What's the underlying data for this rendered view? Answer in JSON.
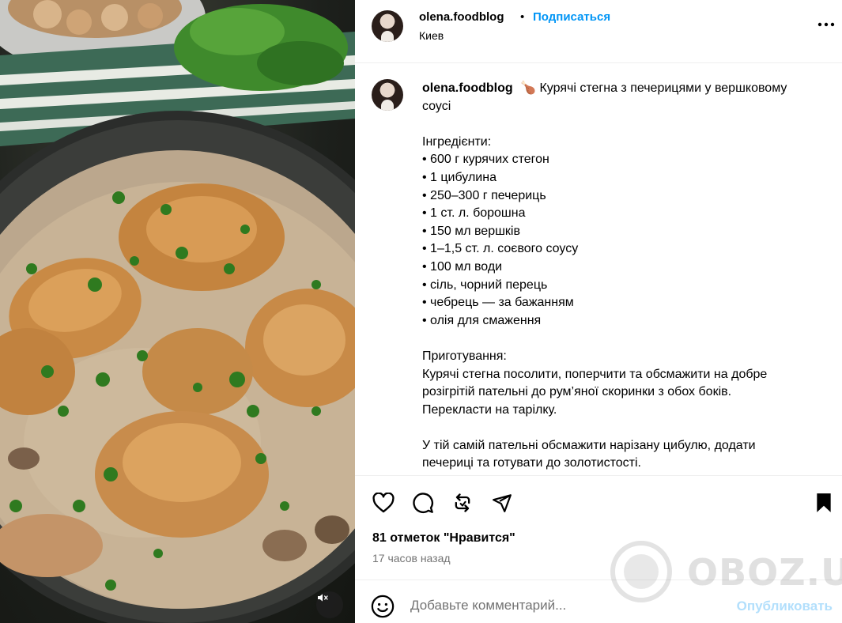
{
  "post": {
    "username": "olena.foodblog",
    "separator": "•",
    "follow_label": "Подписаться",
    "location": "Киев",
    "caption_emoji": "🍗",
    "caption_lines": [
      "Курячі стегна з печерицями у вершковому",
      "соусі",
      "",
      "Інгредієнти:",
      "• 600 г курячих стегон",
      "• 1 цибулина",
      "• 250–300 г печериць",
      "• 1 ст. л. борошна",
      "• 150 мл вершків",
      "• 1–1,5 ст. л. соєвого соусу",
      "• 100 мл води",
      "• сіль, чорний перець",
      "• чебрець — за бажанням",
      "• олія для смаження",
      "",
      "Приготування:",
      "Курячі стегна посолити, поперчити та обсмажити на добре",
      "розігрітій пательні до рум’яної скоринки з обох боків.",
      "Перекласти на тарілку.",
      "",
      "У тій самій пательні обсмажити нарізану цибулю, додати",
      "печериці та готувати до золотистості."
    ],
    "likes": "81 отметок \"Нравится\"",
    "time_ago": "17 часов назад"
  },
  "comment": {
    "placeholder": "Добавьте комментарий...",
    "publish_label": "Опубликовать"
  },
  "watermark": {
    "text": "OBOZ.UA"
  },
  "icons": {
    "more": "more-options-icon",
    "like": "heart-icon",
    "comment": "comment-icon",
    "share": "repost-icon",
    "send": "send-icon",
    "save": "bookmark-icon",
    "emoji": "emoji-icon",
    "mute": "sound-off-icon"
  },
  "colors": {
    "link": "#0095f6",
    "publish_disabled": "#b2dffc",
    "secondary_text": "#737373",
    "divider": "#efefef"
  }
}
